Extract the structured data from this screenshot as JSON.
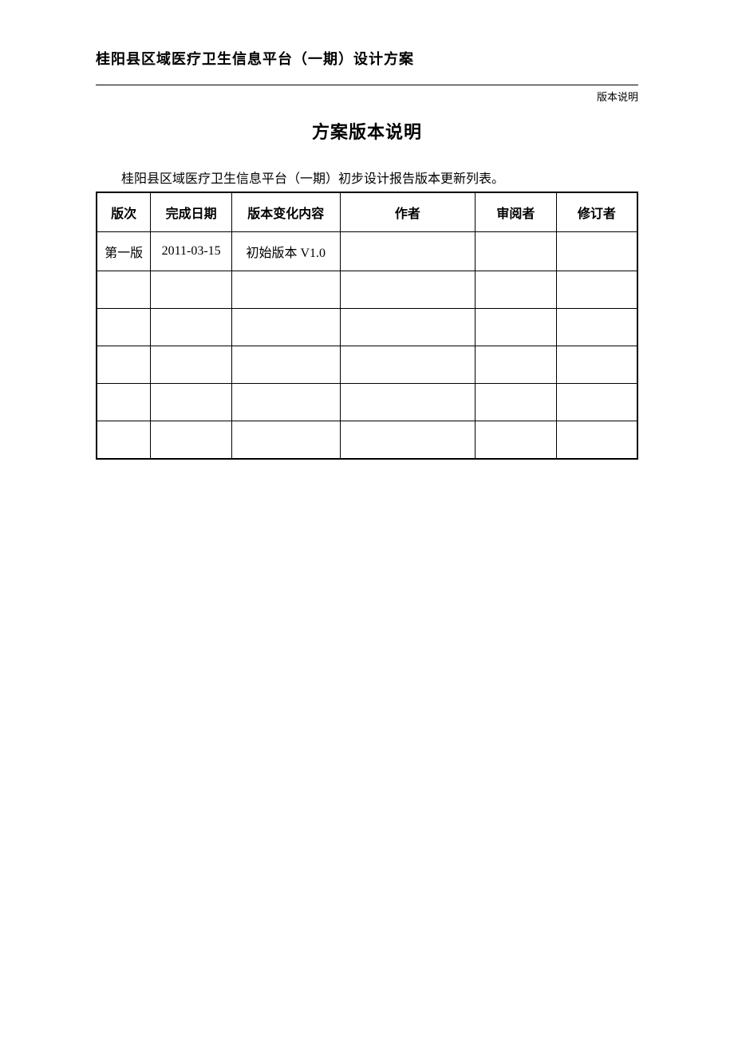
{
  "header": {
    "doc_title": "桂阳县区域医疗卫生信息平台（一期）设计方案",
    "section_label": "版本说明"
  },
  "main": {
    "title": "方案版本说明",
    "caption": "桂阳县区域医疗卫生信息平台（一期）初步设计报告版本更新列表。"
  },
  "table": {
    "headers": {
      "version": "版次",
      "date": "完成日期",
      "change": "版本变化内容",
      "author": "作者",
      "reviewer": "审阅者",
      "reviser": "修订者"
    },
    "rows": [
      {
        "version": "第一版",
        "date": "2011-03-15",
        "change": "初始版本 V1.0",
        "author": "",
        "reviewer": "",
        "reviser": ""
      },
      {
        "version": "",
        "date": "",
        "change": "",
        "author": "",
        "reviewer": "",
        "reviser": ""
      },
      {
        "version": "",
        "date": "",
        "change": "",
        "author": "",
        "reviewer": "",
        "reviser": ""
      },
      {
        "version": "",
        "date": "",
        "change": "",
        "author": "",
        "reviewer": "",
        "reviser": ""
      },
      {
        "version": "",
        "date": "",
        "change": "",
        "author": "",
        "reviewer": "",
        "reviser": ""
      },
      {
        "version": "",
        "date": "",
        "change": "",
        "author": "",
        "reviewer": "",
        "reviser": ""
      }
    ]
  }
}
